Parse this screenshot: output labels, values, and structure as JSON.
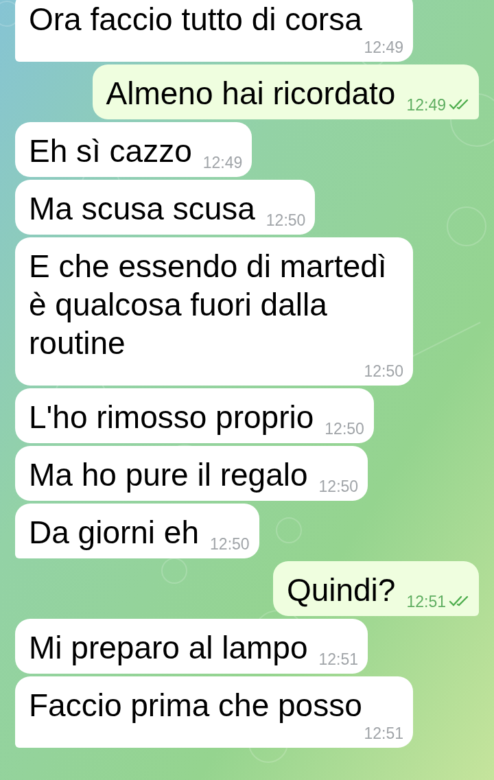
{
  "messages": [
    {
      "outgoing": false,
      "text": "Ora faccio tutto di corsa",
      "time": "12:49"
    },
    {
      "outgoing": true,
      "text": "Almeno hai ricordato",
      "time": "12:49",
      "read": true
    },
    {
      "outgoing": false,
      "text": "Eh sì cazzo",
      "time": "12:49"
    },
    {
      "outgoing": false,
      "text": "Ma scusa scusa",
      "time": "12:50"
    },
    {
      "outgoing": false,
      "text": "E che essendo di martedì è qualcosa fuori dalla routine",
      "time": "12:50"
    },
    {
      "outgoing": false,
      "text": "L'ho rimosso proprio",
      "time": "12:50"
    },
    {
      "outgoing": false,
      "text": "Ma ho pure il regalo",
      "time": "12:50"
    },
    {
      "outgoing": false,
      "text": "Da giorni eh",
      "time": "12:50"
    },
    {
      "outgoing": true,
      "text": "Quindi?",
      "time": "12:51",
      "read": true
    },
    {
      "outgoing": false,
      "text": "Mi preparo al lampo",
      "time": "12:51"
    },
    {
      "outgoing": false,
      "text": "Faccio prima che posso",
      "time": "12:51"
    }
  ]
}
